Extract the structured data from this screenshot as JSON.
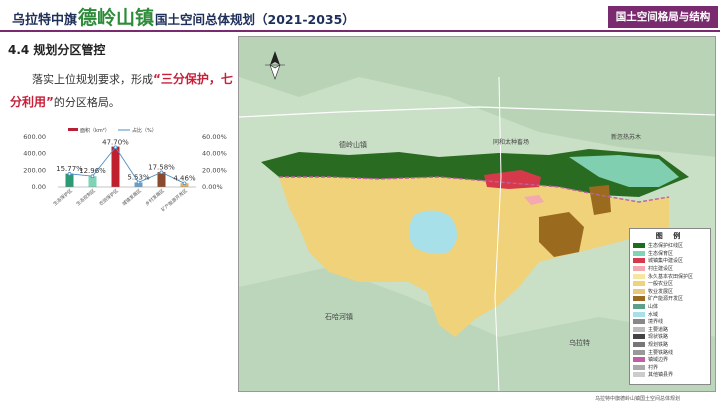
{
  "header": {
    "title_prefix": "乌拉特中旗",
    "title_town": "德岭山镇",
    "title_suffix": "国土空间总体规划（2021-2035）",
    "section": "国土空间格局与结构"
  },
  "section_title": "4.4 规划分区管控",
  "paragraph": {
    "before": "落实上位规划要求，形成",
    "highlight": "“三分保护，七分利用”",
    "after": "的分区格局。"
  },
  "chart_data": {
    "type": "bar",
    "series": [
      {
        "name": "面积（km²）",
        "values": [
          160.3,
          128.6,
          485.0,
          55.0,
          178.6,
          45.3
        ],
        "color": "#b81e36"
      },
      {
        "name": "占比（%）",
        "values": [
          15.77,
          12.96,
          47.7,
          5.53,
          17.58,
          4.46
        ],
        "color": "#4a90c8"
      }
    ],
    "categories": [
      "生态保护区",
      "生态控制区",
      "农田保护区",
      "城镇发展区",
      "乡村发展区",
      "矿产能源开发区"
    ],
    "bar_colors": [
      "#2e9a73",
      "#7fd3b6",
      "#c0202e",
      "#6aa0c8",
      "#8b4a2e",
      "#d8b36a"
    ],
    "data_labels": [
      "15.77%",
      "12.96%",
      "47.70%",
      "5.53%",
      "17.58%",
      "4.46%"
    ],
    "y_left_ticks": [
      "600.00",
      "400.00",
      "200.00",
      "0.00"
    ],
    "y_right_ticks": [
      "60.00%",
      "40.00%",
      "20.00%",
      "0.00%"
    ],
    "ylim_left": [
      0,
      600
    ],
    "ylim_right": [
      0,
      60
    ]
  },
  "map": {
    "places": [
      "德岭山镇",
      "同和太种畜场",
      "新忽热苏木",
      "石哈河镇",
      "乌拉特"
    ],
    "legend_title": "图 例",
    "legend": [
      {
        "label": "生态保护红线区",
        "color": "#1f6b1f"
      },
      {
        "label": "生态保育区",
        "color": "#7fd3b6"
      },
      {
        "label": "城镇集中建设区",
        "color": "#d63a4a"
      },
      {
        "label": "村庄建设区",
        "color": "#f4a8b0"
      },
      {
        "label": "永久基本农田保护区",
        "color": "#f5e6a0"
      },
      {
        "label": "一般农业区",
        "color": "#f0d27a"
      },
      {
        "label": "牧业发展区",
        "color": "#e8c87a"
      },
      {
        "label": "矿产能源开发区",
        "color": "#9a6a1e"
      },
      {
        "label": "山体",
        "color": "#5aa08a"
      },
      {
        "label": "水域",
        "color": "#a7e0e8"
      },
      {
        "label": "境界线",
        "color": "#888888"
      },
      {
        "label": "主要道路",
        "color": "#bbbbbb"
      },
      {
        "label": "现状铁路",
        "color": "#444444"
      },
      {
        "label": "规划铁路",
        "color": "#777777"
      },
      {
        "label": "主要铁路线",
        "color": "#999999"
      },
      {
        "label": "镇域边界",
        "color": "#c060a0"
      },
      {
        "label": "村界",
        "color": "#aaaaaa"
      },
      {
        "label": "其他镇县界",
        "color": "#cccccc"
      }
    ]
  },
  "footer": "乌拉特中旗德岭山镇国土空间总体规划"
}
